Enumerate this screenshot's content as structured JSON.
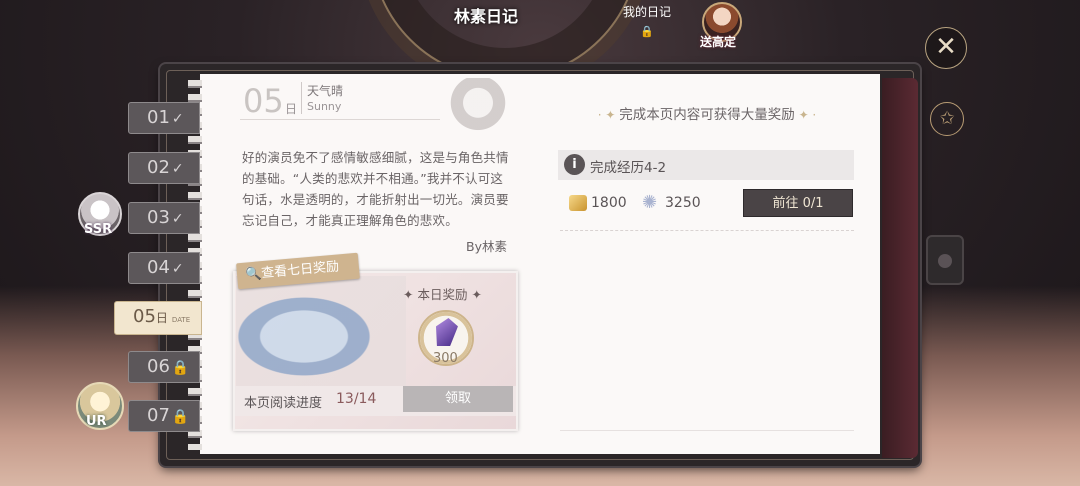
{
  "header": {
    "title": "林素日记",
    "my_diary": "我的日记",
    "gift_label": "送高定"
  },
  "tabs": [
    {
      "label": "01",
      "state": "done"
    },
    {
      "label": "02",
      "state": "done"
    },
    {
      "label": "03",
      "state": "done"
    },
    {
      "label": "04",
      "state": "done"
    },
    {
      "label": "05",
      "day": "日",
      "small": "DATE",
      "state": "active"
    },
    {
      "label": "06",
      "state": "locked"
    },
    {
      "label": "07",
      "state": "locked"
    }
  ],
  "avatars": {
    "ssr_label": "SSR",
    "ur_label": "UR"
  },
  "diary": {
    "date": "05",
    "day": "日",
    "weather_cn": "天气晴",
    "weather_en": "Sunny",
    "body": "好的演员免不了感情敏感细腻，这是与角色共情的基础。“人类的悲欢并不相通。”我并不认可这句话，水是透明的，才能折射出一切光。演员要忘记自己，才能真正理解角色的悲欢。",
    "byline": "By林素"
  },
  "reward": {
    "view7_label": "查看七日奖励",
    "today_label": "本日奖励",
    "amount": "300",
    "progress_label": "本页阅读进度",
    "progress_value": "13/14",
    "progress_current": 13,
    "progress_total": 14,
    "claim_label": "领取"
  },
  "task": {
    "header": "完成本页内容可获得大量奖励",
    "title": "完成经历4-2",
    "gold": "1800",
    "stars": "3250",
    "goto_label": "前往 0/1"
  },
  "icons": {
    "close": "close-icon",
    "lock": "lock-icon",
    "check": "check-icon",
    "info": "info-icon",
    "search": "search-icon",
    "gem": "gem-icon"
  },
  "colors": {
    "accent_gold": "#cfb48f",
    "button_dark": "#4a4446",
    "tab_active": "#f2e6cf"
  }
}
